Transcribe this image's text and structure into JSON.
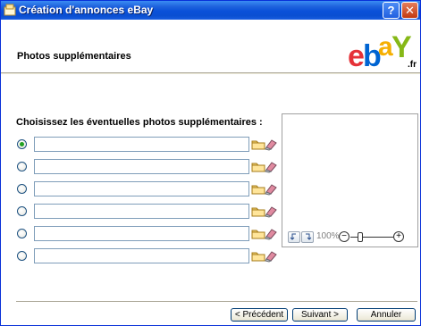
{
  "window": {
    "title": "Création d'annonces eBay",
    "help_label": "?",
    "close_label": "✕"
  },
  "header": {
    "title": "Photos supplémentaires",
    "logo_suffix": ".fr"
  },
  "main": {
    "instruction": "Choisissez les éventuelles photos supplémentaires :",
    "photo_rows": [
      {
        "selected": true,
        "value": ""
      },
      {
        "selected": false,
        "value": ""
      },
      {
        "selected": false,
        "value": ""
      },
      {
        "selected": false,
        "value": ""
      },
      {
        "selected": false,
        "value": ""
      },
      {
        "selected": false,
        "value": ""
      }
    ],
    "preview": {
      "zoom_label": "100%",
      "zoom_minus": "−",
      "zoom_plus": "+"
    }
  },
  "footer": {
    "prev_label": "< Précédent",
    "next_label": "Suivant >",
    "cancel_label": "Annuler"
  },
  "colors": {
    "ebay_e": "#e53238",
    "ebay_b": "#0064d2",
    "ebay_a": "#f5af02",
    "ebay_y": "#86b817"
  }
}
